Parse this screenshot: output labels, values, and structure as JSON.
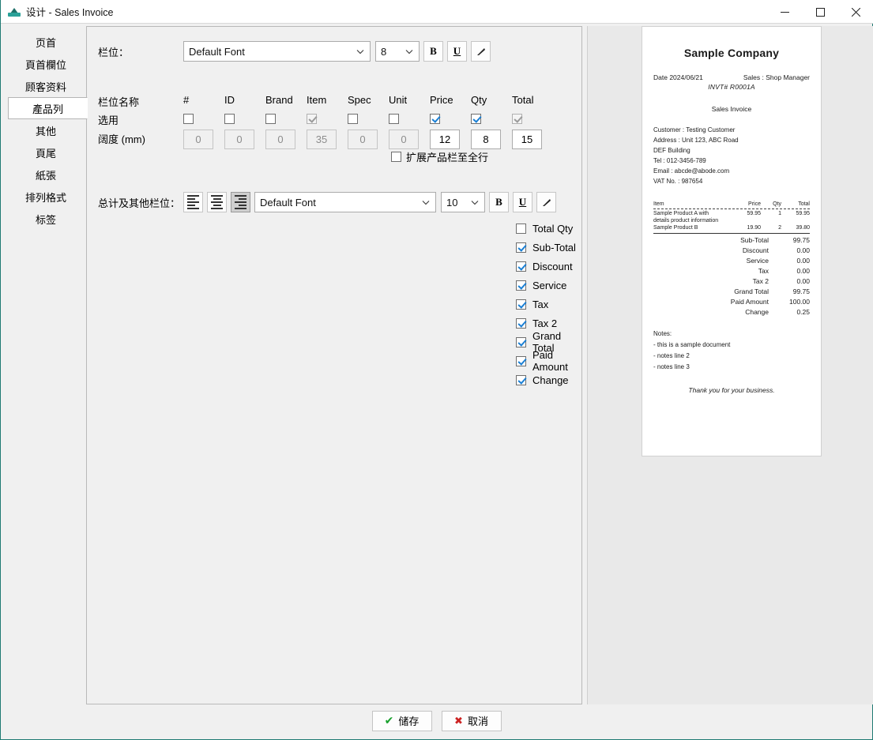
{
  "window": {
    "title": "设计 - Sales Invoice",
    "icon": "app-printer-icon",
    "minimize_label": "—",
    "maximize_label": "□",
    "close_label": "✕"
  },
  "sidebar": {
    "items": [
      {
        "label": "页首",
        "active": false
      },
      {
        "label": "頁首欄位",
        "active": false
      },
      {
        "label": "顾客资料",
        "active": false
      },
      {
        "label": "產品列",
        "active": true
      },
      {
        "label": "其他",
        "active": false
      },
      {
        "label": "頁尾",
        "active": false
      },
      {
        "label": "紙張",
        "active": false
      },
      {
        "label": "排列格式",
        "active": false
      },
      {
        "label": "标签",
        "active": false
      }
    ]
  },
  "columns_section": {
    "font_row_label": "栏位：",
    "font_family": "Default Font",
    "font_size": "8",
    "bold_label": "B",
    "underline_label": "U",
    "italic_label": "italic-slant-icon",
    "row_labels": {
      "name": "栏位名称",
      "use": "选用",
      "width": "阔度 (mm)"
    },
    "columns": [
      {
        "name": "#",
        "checked": false,
        "disabled": false,
        "width": "0",
        "width_disabled": true
      },
      {
        "name": "ID",
        "checked": false,
        "disabled": false,
        "width": "0",
        "width_disabled": true
      },
      {
        "name": "Brand",
        "checked": false,
        "disabled": false,
        "width": "0",
        "width_disabled": true
      },
      {
        "name": "Item",
        "checked": true,
        "disabled": true,
        "width": "35",
        "width_disabled": true
      },
      {
        "name": "Spec",
        "checked": false,
        "disabled": false,
        "width": "0",
        "width_disabled": true
      },
      {
        "name": "Unit",
        "checked": false,
        "disabled": false,
        "width": "0",
        "width_disabled": true
      },
      {
        "name": "Price",
        "checked": true,
        "disabled": false,
        "width": "12",
        "width_disabled": false
      },
      {
        "name": "Qty",
        "checked": true,
        "disabled": false,
        "width": "8",
        "width_disabled": false
      },
      {
        "name": "Total",
        "checked": true,
        "disabled": true,
        "width": "15",
        "width_disabled": false
      }
    ],
    "expand_label": "扩展产品栏至全行",
    "expand_checked": false
  },
  "totals_section": {
    "row_label": "总计及其他栏位：",
    "align_left_label": "align-left-icon",
    "align_center_label": "align-center-icon",
    "align_right_label": "align-right-icon",
    "align_selected": "right",
    "font_family": "Default Font",
    "font_size": "10",
    "bold_label": "B",
    "underline_label": "U",
    "italic_label": "italic-slant-icon",
    "fields": [
      {
        "label": "Total Qty",
        "checked": false
      },
      {
        "label": "Sub-Total",
        "checked": true
      },
      {
        "label": "Discount",
        "checked": true
      },
      {
        "label": "Service",
        "checked": true
      },
      {
        "label": "Tax",
        "checked": true
      },
      {
        "label": "Tax 2",
        "checked": true
      },
      {
        "label": "Grand Total",
        "checked": true
      },
      {
        "label": "Paid Amount",
        "checked": true
      },
      {
        "label": "Change",
        "checked": true
      }
    ]
  },
  "preview": {
    "company": "Sample Company",
    "date": "Date 2024/06/21",
    "sales": "Sales : Shop Manager",
    "invoice_no": "INVT# R0001A",
    "doc_type": "Sales Invoice",
    "customer_lines": [
      "Customer : Testing Customer",
      "Address : Unit 123, ABC Road",
      "DEF Building",
      "Tel : 012-3456-789",
      "Email : abcde@abode.com",
      "VAT No. : 987654"
    ],
    "table_headers": {
      "item": "Item",
      "price": "Price",
      "qty": "Qty",
      "total": "Total"
    },
    "items": [
      {
        "item": "Sample Product A with",
        "price": "59.95",
        "qty": "1",
        "total": "59.95"
      },
      {
        "item": "details product information",
        "price": "",
        "qty": "",
        "total": ""
      },
      {
        "item": "Sample Product B",
        "price": "19.90",
        "qty": "2",
        "total": "39.80"
      }
    ],
    "totals": [
      {
        "label": "Sub-Total",
        "value": "99.75"
      },
      {
        "label": "Discount",
        "value": "0.00"
      },
      {
        "label": "Service",
        "value": "0.00"
      },
      {
        "label": "Tax",
        "value": "0.00"
      },
      {
        "label": "Tax 2",
        "value": "0.00"
      },
      {
        "label": "Grand Total",
        "value": "99.75"
      },
      {
        "label": "Paid Amount",
        "value": "100.00"
      },
      {
        "label": "Change",
        "value": "0.25"
      }
    ],
    "notes_title": "Notes:",
    "notes": [
      "- this is a sample document",
      "- notes line 2",
      "- notes line 3"
    ],
    "thanks": "Thank you for your business."
  },
  "footer": {
    "save_label": "储存",
    "cancel_label": "取消",
    "save_icon": "check-icon",
    "cancel_icon": "cross-icon"
  },
  "colors": {
    "accent_teal": "#1f7a73",
    "check_blue": "#1a7fd4",
    "check_green": "#17a02c",
    "cross_red": "#cc2222",
    "panel_bg": "#f0f0f0"
  }
}
